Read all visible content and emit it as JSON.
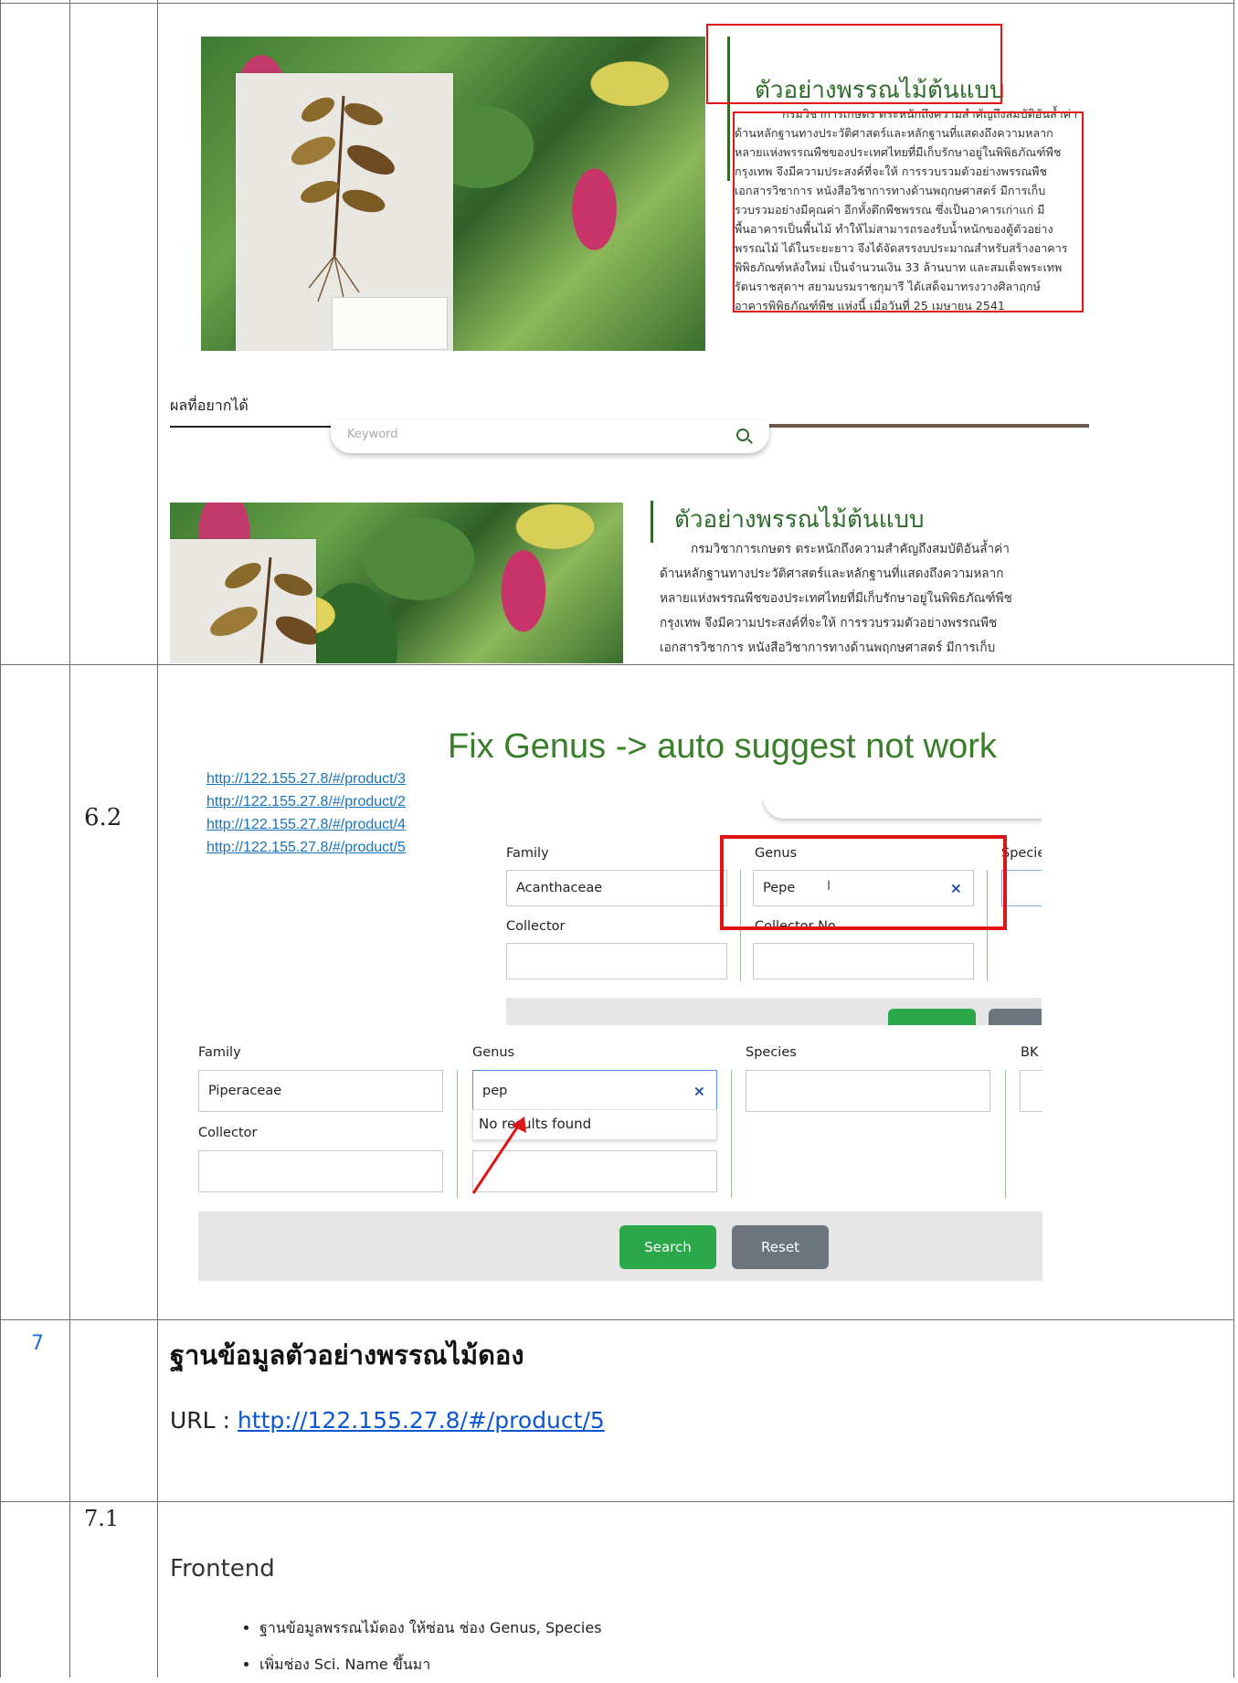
{
  "rows": {
    "row6_2_number": "6.2",
    "row7_number": "7",
    "row7_1_number": "7.1"
  },
  "sample_top": {
    "title": "ตัวอย่างพรรณไม้ต้นแบบ",
    "lines": [
      "กรมวิชาการเกษตร ตระหนักถึงความสำคัญถึงสมบัติอันล้ำค่า",
      "ด้านหลักฐานทางประวัติศาสตร์และหลักฐานที่แสดงถึงความหลาก",
      "หลายแห่งพรรณพืชของประเทศไทยที่มีเก็บรักษาอยู่ในพิพิธภัณฑ์พืช",
      "กรุงเทพ จึงมีความประสงค์ที่จะให้ การรวบรวมตัวอย่างพรรณพืช",
      "เอกสารวิชาการ หนังสือวิชาการทางด้านพฤกษศาสตร์ มีการเก็บ",
      "รวบรวมอย่างมีคุณค่า อีกทั้งตึกพืชพรรณ ซึ่งเป็นอาคารเก่าแก่ มี",
      "พื้นอาคารเป็นพื้นไม้ ทำให้ไม่สามารถรองรับน้ำหนักของตู้ตัวอย่าง",
      "พรรณไม้ ได้ในระยะยาว จึงได้จัดสรรงบประมาณสำหรับสร้างอาคาร",
      "พิพิธภัณฑ์หลังใหม่ เป็นจำนวนเงิน 33 ล้านบาท และสมเด็จพระเทพ",
      "รัตนราชสุดาฯ สยามบรมราชกุมารี ได้เสด็จมาทรงวางศิลาฤกษ์",
      "อาคารพิพิธภัณฑ์พืช แห่งนี้ เมื่อวันที่ 25 เมษายน 2541"
    ]
  },
  "desired_label": "ผลที่อยากได้",
  "keyword_placeholder": "Keyword",
  "sample_bottom": {
    "title": "ตัวอย่างพรรณไม้ต้นแบบ",
    "lines": [
      "กรมวิชาการเกษตร ตระหนักถึงความสำคัญถึงสมบัติอันล้ำค่า",
      "ด้านหลักฐานทางประวัติศาสตร์และหลักฐานที่แสดงถึงความหลาก",
      "หลายแห่งพรรณพืชของประเทศไทยที่มีเก็บรักษาอยู่ในพิพิธภัณฑ์พืช",
      "กรุงเทพ จึงมีความประสงค์ที่จะให้ การรวบรวมตัวอย่างพรรณพืช",
      "เอกสารวิชาการ หนังสือวิชาการทางด้านพฤกษศาสตร์ มีการเก็บ"
    ]
  },
  "fix_title": "Fix Genus -> auto suggest not work",
  "links": [
    "http://122.155.27.8/#/product/3",
    "http://122.155.27.8/#/product/2",
    "http://122.155.27.8/#/product/4",
    "http://122.155.27.8/#/product/5"
  ],
  "form1": {
    "family_label": "Family",
    "family_value": "Acanthaceae",
    "genus_label": "Genus",
    "genus_value": "Pepe",
    "species_label": "Specie",
    "collector_label": "Collector",
    "collector_no_label": "Collector No."
  },
  "form2": {
    "family_label": "Family",
    "family_value": "Piperaceae",
    "genus_label": "Genus",
    "genus_value": "pep",
    "species_label": "Species",
    "bk_label": "BK",
    "no_results": "No results found",
    "collector_label": "Collector",
    "search_label": "Search",
    "reset_label": "Reset"
  },
  "section7": {
    "title": "ฐานข้อมูลตัวอย่างพรรณไม้ดอง",
    "url_prefix": "URL : ",
    "url": "http://122.155.27.8/#/product/5"
  },
  "section7_1": {
    "heading": "Frontend",
    "bullets": [
      "ฐานข้อมูลพรรณไม้ดอง ให้ซ่อน ช่อง Genus, Species",
      "เพิ่มช่อง Sci. Name ขึ้นมา"
    ]
  },
  "colors": {
    "green_button": "#2aa84a",
    "gray_button": "#6c757d",
    "red_annotation": "#e01414",
    "title_green": "#2e6b2b"
  }
}
